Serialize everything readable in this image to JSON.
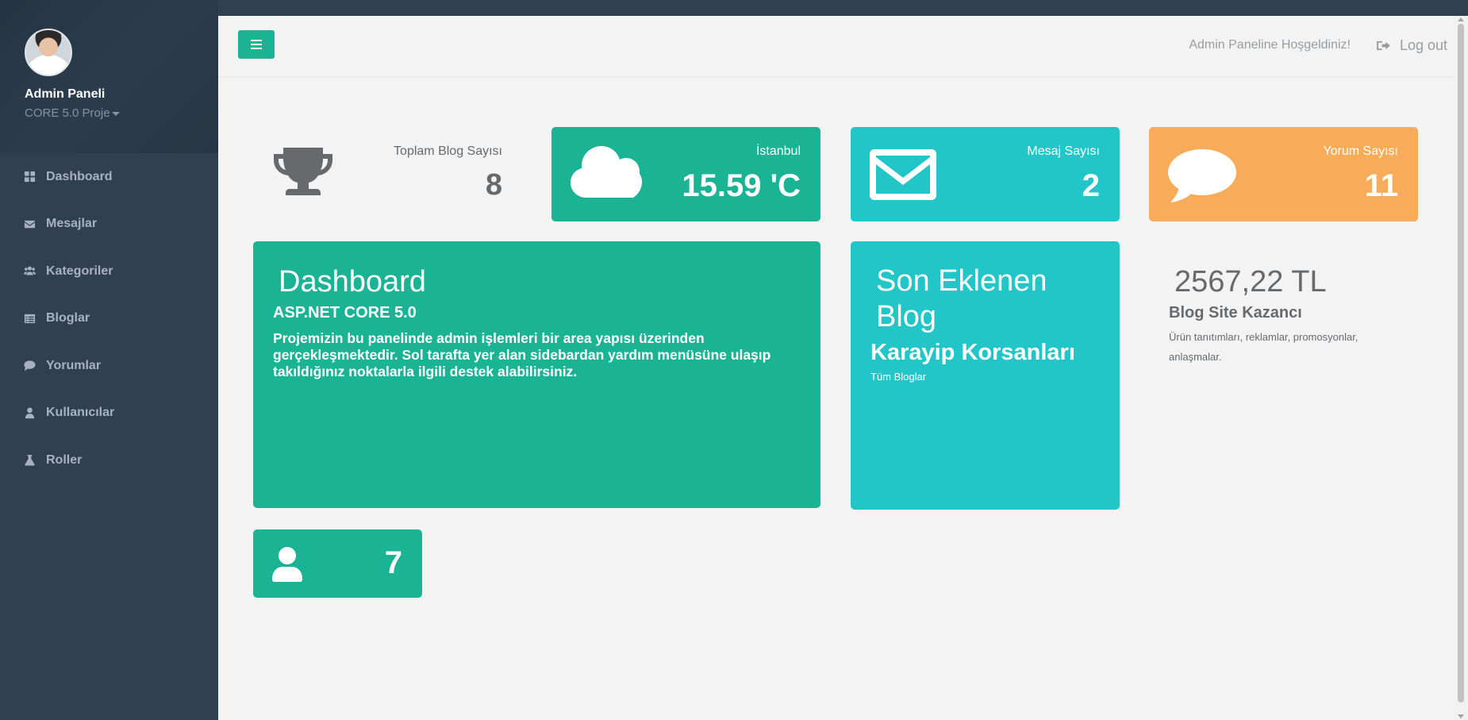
{
  "sidebar": {
    "profile_name": "Admin Paneli",
    "profile_sub": "CORE 5.0 Proje",
    "items": [
      {
        "label": "Dashboard",
        "icon": "dashboard-icon"
      },
      {
        "label": "Mesajlar",
        "icon": "envelope-icon"
      },
      {
        "label": "Kategoriler",
        "icon": "users-icon"
      },
      {
        "label": "Bloglar",
        "icon": "list-icon"
      },
      {
        "label": "Yorumlar",
        "icon": "comment-icon"
      },
      {
        "label": "Kullanıcılar",
        "icon": "user-icon"
      },
      {
        "label": "Roller",
        "icon": "flask-icon"
      }
    ]
  },
  "header": {
    "welcome": "Admin Paneline Hoşgeldiniz!",
    "logout": "Log out"
  },
  "widgets": {
    "blog_count": {
      "label": "Toplam Blog Sayısı",
      "value": "8"
    },
    "weather": {
      "label": "İstanbul",
      "value": "15.59 'C"
    },
    "messages": {
      "label": "Mesaj Sayısı",
      "value": "2"
    },
    "comments": {
      "label": "Yorum Sayısı",
      "value": "11"
    },
    "users": {
      "value": "7"
    }
  },
  "dashboard": {
    "title": "Dashboard",
    "subtitle": "ASP.NET CORE 5.0",
    "text": "Projemizin bu panelinde admin işlemleri bir area yapısı üzerinden gerçekleşmektedir. Sol tarafta yer alan sidebardan yardım menüsüne ulaşıp takıldığınız noktalarla ilgili destek alabilirsiniz."
  },
  "last_blog": {
    "title": "Son Eklenen Blog",
    "name": "Karayip Korsanları",
    "link": "Tüm Bloglar"
  },
  "earnings": {
    "value": "2567,22 TL",
    "title": "Blog Site Kazancı",
    "desc": "Ürün tanıtımları, reklamlar, promosyonlar, anlaşmalar."
  },
  "colors": {
    "sidebar": "#2f4050",
    "primary": "#1ab394",
    "info": "#23c6c8",
    "warning": "#f8ac59"
  }
}
